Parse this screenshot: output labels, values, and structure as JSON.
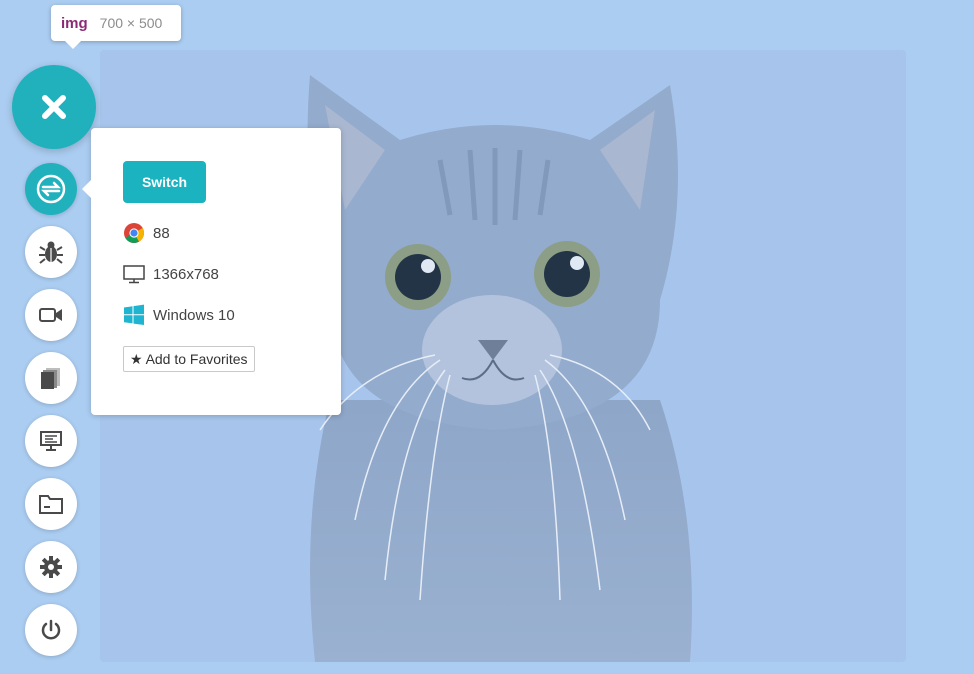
{
  "tooltip": {
    "tag": "img",
    "dimensions": "700 × 500"
  },
  "toolbar": {
    "close_icon": "close-icon",
    "items": [
      {
        "name": "switch-session",
        "icon": "switch-icon",
        "active": true
      },
      {
        "name": "bug-report",
        "icon": "bug-icon"
      },
      {
        "name": "record-video",
        "icon": "video-camera-icon"
      },
      {
        "name": "screenshots",
        "icon": "gallery-icon"
      },
      {
        "name": "resolution",
        "icon": "display-settings-icon"
      },
      {
        "name": "files",
        "icon": "folder-icon"
      },
      {
        "name": "settings",
        "icon": "gear-icon"
      },
      {
        "name": "power",
        "icon": "power-icon"
      }
    ]
  },
  "popup": {
    "switch_label": "Switch",
    "browser_version": "88",
    "resolution": "1366x768",
    "os": "Windows 10",
    "favorites_label": "Add to Favorites"
  },
  "colors": {
    "accent": "#21b1bd",
    "overlay": "#abcdf1",
    "tag_color": "#8b2a75"
  }
}
